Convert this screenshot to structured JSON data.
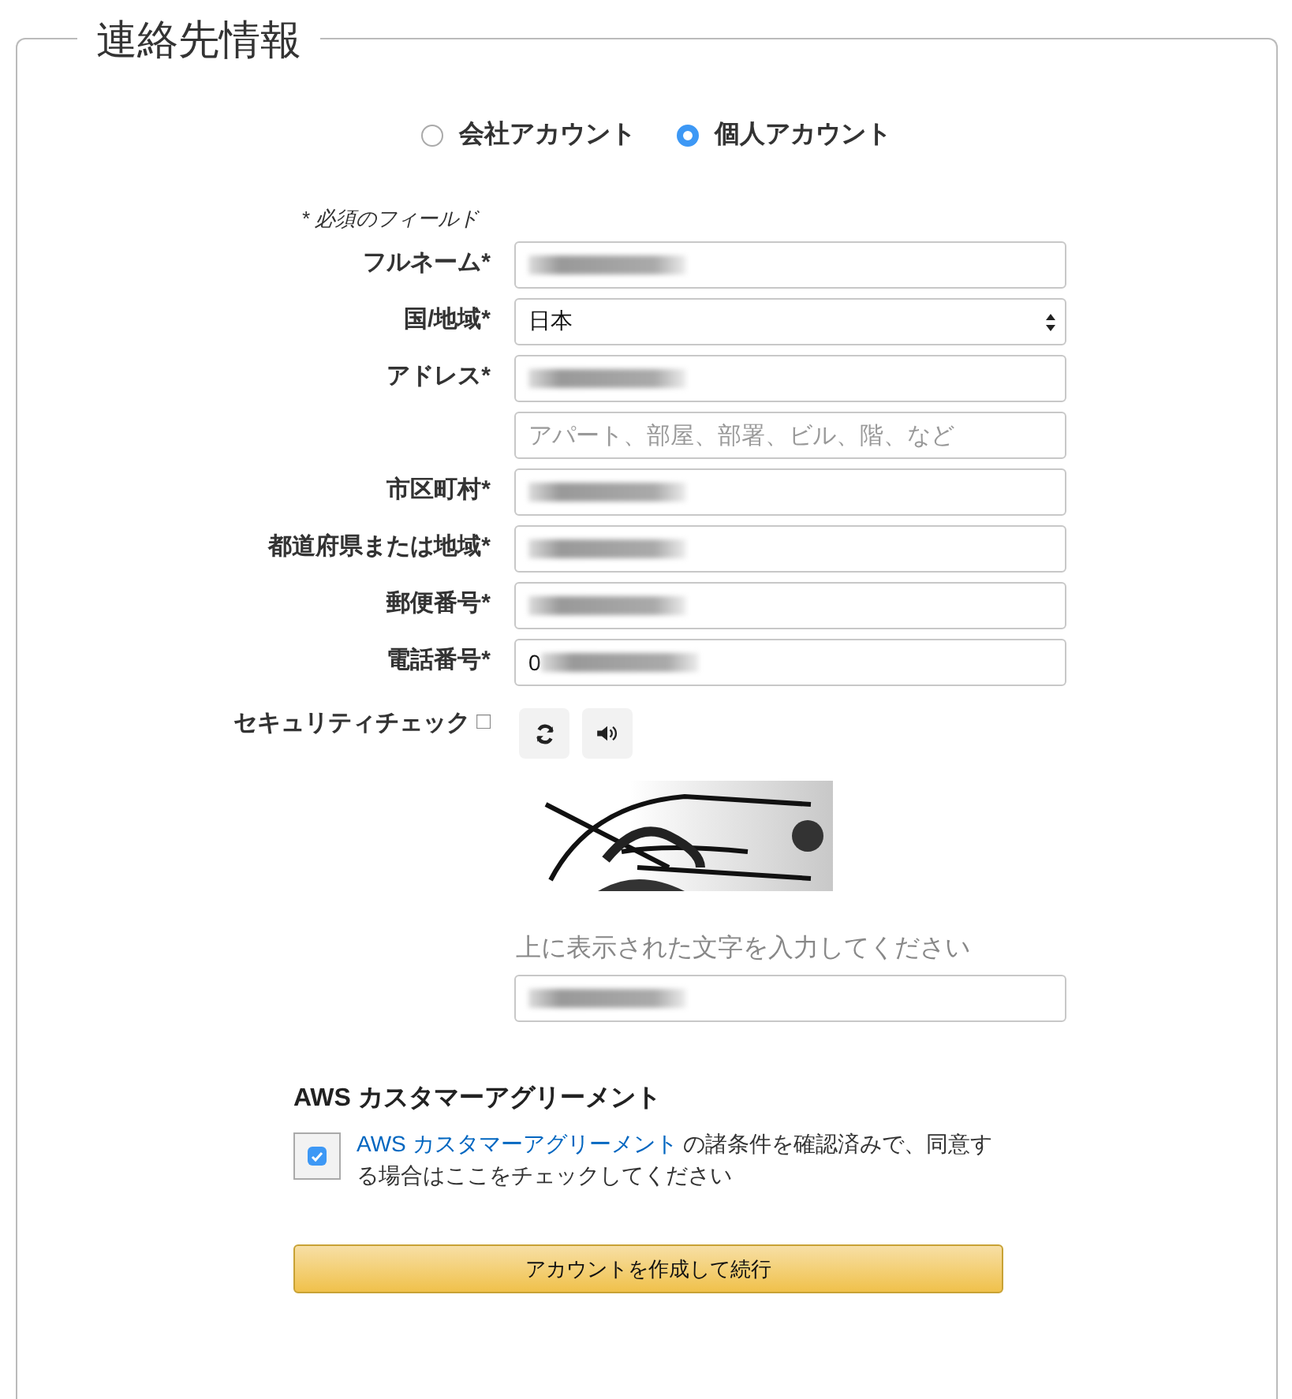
{
  "section_title": "連絡先情報",
  "account_types": [
    {
      "label": "会社アカウント",
      "selected": false
    },
    {
      "label": "個人アカウント",
      "selected": true
    }
  ],
  "required_note": "* 必須のフィールド",
  "fields": [
    {
      "label": "フルネーム*",
      "kind": "input",
      "redacted": true
    },
    {
      "label": "国/地域*",
      "kind": "select",
      "value": "日本"
    },
    {
      "label": "アドレス*",
      "kind": "input",
      "redacted": true
    },
    {
      "kind": "input",
      "placeholder": "アパート、部屋、部署、ビル、階、など"
    },
    {
      "label": "市区町村*",
      "kind": "input",
      "redacted": true
    },
    {
      "label": "都道府県または地域*",
      "kind": "input",
      "redacted": true
    },
    {
      "label": "郵便番号*",
      "kind": "input",
      "redacted": true
    },
    {
      "label": "電話番号*",
      "kind": "input",
      "value": "0",
      "redacted": true
    }
  ],
  "security": {
    "label": "セキュリティチェック",
    "info_mark": "□",
    "buttons": [
      {
        "kind": "refresh"
      },
      {
        "kind": "audio"
      }
    ],
    "hint": "上に表示された文字を入力してください",
    "answer_redacted": true
  },
  "agreement": {
    "heading": "AWS カスタマーアグリーメント",
    "checked": true,
    "link": "AWS カスタマーアグリーメント",
    "text": " の諸条件を確認済みで、同意する場合はここをチェックしてください"
  },
  "submit": "アカウントを作成して続行"
}
